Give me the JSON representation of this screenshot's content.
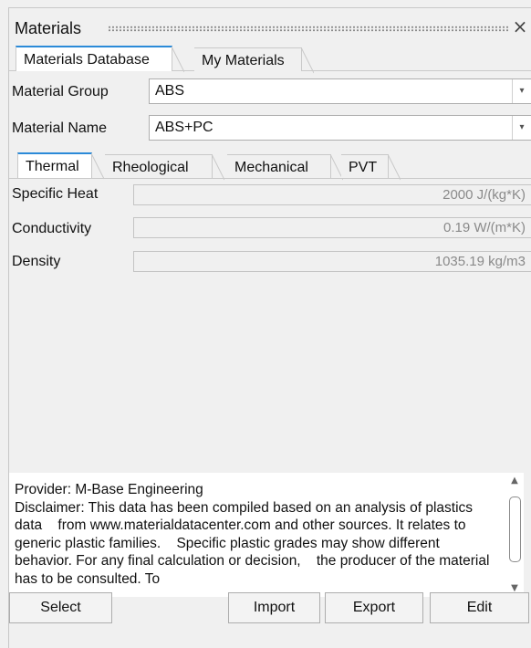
{
  "panel": {
    "title": "Materials",
    "close_icon": "close-icon"
  },
  "main_tabs": [
    {
      "label": "Materials Database",
      "active": true
    },
    {
      "label": "My Materials",
      "active": false
    }
  ],
  "material_group": {
    "label": "Material Group",
    "value": "ABS"
  },
  "material_name": {
    "label": "Material Name",
    "value": "ABS+PC"
  },
  "property_tabs": [
    {
      "label": "Thermal",
      "active": true
    },
    {
      "label": "Rheological",
      "active": false
    },
    {
      "label": "Mechanical",
      "active": false
    },
    {
      "label": "PVT",
      "active": false
    }
  ],
  "properties": [
    {
      "label": "Specific Heat",
      "value": "2000 J/(kg*K)"
    },
    {
      "label": "Conductivity",
      "value": "0.19 W/(m*K)"
    },
    {
      "label": "Density",
      "value": "1035.19 kg/m3"
    }
  ],
  "info_text": "Provider: M-Base Engineering\nDisclaimer: This data has been compiled based on an analysis of plastics data    from www.materialdatacenter.com and other sources. It relates to generic plastic families.    Specific plastic grades may show different behavior. For any final calculation or decision,    the producer of the material has to be consulted. To",
  "buttons": {
    "select": "Select",
    "import": "Import",
    "export": "Export",
    "edit": "Edit"
  },
  "colors": {
    "accent": "#2b8ad8",
    "background": "#f0f0f0"
  }
}
